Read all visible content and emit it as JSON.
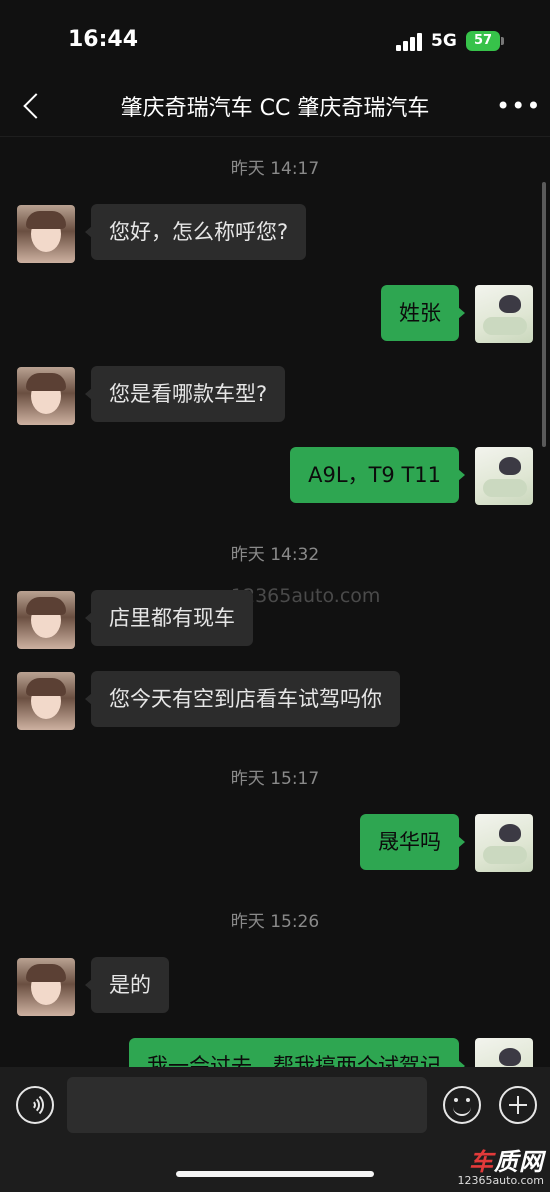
{
  "status_bar": {
    "time": "16:44",
    "network": "5G",
    "battery": "57"
  },
  "nav": {
    "title": "肇庆奇瑞汽车 CC 肇庆奇瑞汽车",
    "more_label": "•••"
  },
  "chat": {
    "timestamps": [
      "昨天 14:17",
      "昨天 14:32",
      "昨天 15:17",
      "昨天 15:26"
    ],
    "messages": [
      {
        "side": "in",
        "text": "您好，怎么称呼您?"
      },
      {
        "side": "out",
        "text": "姓张"
      },
      {
        "side": "in",
        "text": "您是看哪款车型?"
      },
      {
        "side": "out",
        "text": "A9L，T9 T11"
      },
      {
        "side": "in",
        "text": "店里都有现车"
      },
      {
        "side": "in",
        "text": "您今天有空到店看车试驾吗你"
      },
      {
        "side": "out",
        "text": "晟华吗"
      },
      {
        "side": "in",
        "text": "是的"
      },
      {
        "side": "out",
        "text": "我一会过去，帮我搞两个试驾记"
      }
    ],
    "watermark": "www.12365auto.com"
  },
  "input_bar": {
    "message_value": ""
  },
  "logo": {
    "name_part1": "车",
    "name_part2": "质网",
    "url": "12365auto.com"
  }
}
